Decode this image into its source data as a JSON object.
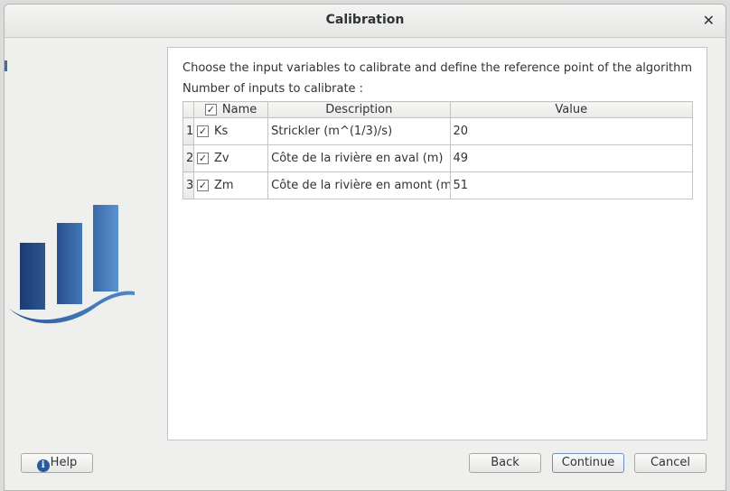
{
  "window": {
    "title": "Calibration"
  },
  "panel": {
    "instruction": "Choose the input variables to calibrate and define the reference point of the algorithm",
    "count_label": "Number of inputs to calibrate :"
  },
  "table": {
    "header_check": "✓",
    "columns": [
      "Name",
      "Description",
      "Value"
    ],
    "rows": [
      {
        "index": "1",
        "checked": "✓",
        "name": "Ks",
        "description": "Strickler (m^(1/3)/s)",
        "value": "20"
      },
      {
        "index": "2",
        "checked": "✓",
        "name": "Zv",
        "description": "Côte de la rivière en aval (m)",
        "value": "49"
      },
      {
        "index": "3",
        "checked": "✓",
        "name": "Zm",
        "description": "Côte de la rivière en amont (m)",
        "value": "51"
      }
    ]
  },
  "buttons": {
    "help": "Help",
    "back": "Back",
    "continue": "Continue",
    "cancel": "Cancel"
  },
  "icons": {
    "close": "close-icon",
    "help": "info-icon",
    "logo": "bar-chart-wave-logo"
  },
  "colors": {
    "logo_dark": "#1f3f78",
    "logo_light": "#4a82c0",
    "panel_bg": "#ffffff"
  }
}
